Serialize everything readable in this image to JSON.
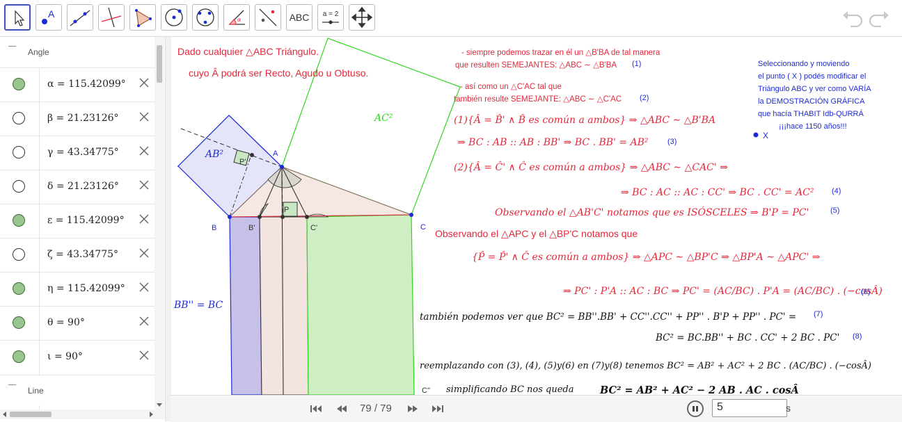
{
  "toolbar": {
    "tools": [
      "move-tool",
      "point-tool",
      "line-tool",
      "perpendicular-line-tool",
      "polygon-tool",
      "circle-center-point-tool",
      "circle-three-points-tool",
      "angle-tool",
      "reflect-tool",
      "text-tool",
      "slider-tool",
      "move-graphics-view-tool"
    ],
    "text_tool_label": "ABC",
    "slider_tool_label": "a = 2"
  },
  "algebra": {
    "angle_header": "Angle",
    "line_header": "Line",
    "angles": [
      {
        "expr": "α = 115.42099°",
        "visible": true
      },
      {
        "expr": "β = 21.23126°",
        "visible": false
      },
      {
        "expr": "γ = 43.34775°",
        "visible": false
      },
      {
        "expr": "δ = 21.23126°",
        "visible": false
      },
      {
        "expr": "ε = 115.42099°",
        "visible": true
      },
      {
        "expr": "ζ = 43.34775°",
        "visible": false
      },
      {
        "expr": "η = 115.42099°",
        "visible": true
      },
      {
        "expr": "θ = 90°",
        "visible": true
      },
      {
        "expr": "ι = 90°",
        "visible": true
      }
    ]
  },
  "graphics": {
    "points": {
      "A": "A",
      "B": "B",
      "C": "C",
      "Bp": "B'",
      "Cp": "C'",
      "P": "P",
      "Pp": "P'",
      "Cpp": "C''",
      "X": "X"
    },
    "square_labels": {
      "AB": "AB²",
      "AC": "AC²"
    },
    "bb_eq": "BB'' = BC",
    "intro1": "Dado cualquier △ABC Triángulo.",
    "intro2": "cuyo Â podrá ser Recto, Agudo u Obtuso.",
    "note1a": "- siempre podemos trazar en él un △B'BA de tal manera",
    "note1b": "que resulten SEMEJANTES: △ABC ∼ △B'BA",
    "note1n": "(1)",
    "note2a": "- así como un △C'AC tal que",
    "note2b": "también resulte SEMEJANTE: △ABC ∼ △C'AC",
    "note2n": "(2)",
    "eq1": "(1){Â = B̂' ∧ B̂ es común a ambos} ⇒ △ABC ∼ △B'BA",
    "eq1b": "⇒ BC : AB :: AB : BB' ⇒ BC . BB' = AB²",
    "eq1bn": "(3)",
    "eq2": "(2){Â = Ĉ' ∧ Ĉ es común a ambos} ⇒ △ABC ∼ △CAC' ⇒",
    "eq2b": "⇒ BC : AC :: AC : CC' ⇒ BC . CC' = AC²",
    "eq2bn": "(4)",
    "eq3": "Observando el △AB'C' notamos que es ISÓSCELES ⇒ B'P = PC'",
    "eq3n": "(5)",
    "eq4": "Observando el △APC y el △BP'C notamos que",
    "eq5": "{P̂ = P̂' ∧ Ĉ es común a ambos} ⇒ △APC ∼ △BP'C ⇒ △BP'A ∼ △APC' ⇒",
    "eq6": "⇒ PC' : P'A :: AC : BC ⇒ PC' = (AC/BC) . P'A = (AC/BC) . (−cosÂ)",
    "eq6n": "(6)",
    "eq7": "también podemos ver que BC² = BB''.BB' + CC''.CC'' + PP'' . B'P + PP'' . PC' =",
    "eq7n": "(7)",
    "eq8": "BC² = BC.BB'' + BC . CC' + 2 BC . PC'",
    "eq8n": "(8)",
    "eq9": "reemplazando con (3), (4), (5)y(6) en (7)y(8) tenemos BC² = AB² + AC² + 2 BC . (AC/BC) . (−cosÂ)",
    "eq10a": "simplificando BC nos queda",
    "eq10b": "BC² = AB² + AC² − 2 AB . AC . cosÂ",
    "side1": "Seleccionando y moviendo",
    "side2": "el punto ( X ) podés modificar el",
    "side3": "Triángulo ABC y ver como VARÍA",
    "side4": "la DEMOSTRACIÓN GRÁFICA",
    "side5": "que hacía THABIT Idb-QURRÁ",
    "side6": "¡¡¡hace 1150 años!!!"
  },
  "playbar": {
    "counter": "79 / 79",
    "speed": "5",
    "unit": "s"
  },
  "colors": {
    "red": "#e5283a",
    "blue": "#1d2bd6",
    "green": "#2fd61d",
    "accent": "#3f51b5"
  }
}
